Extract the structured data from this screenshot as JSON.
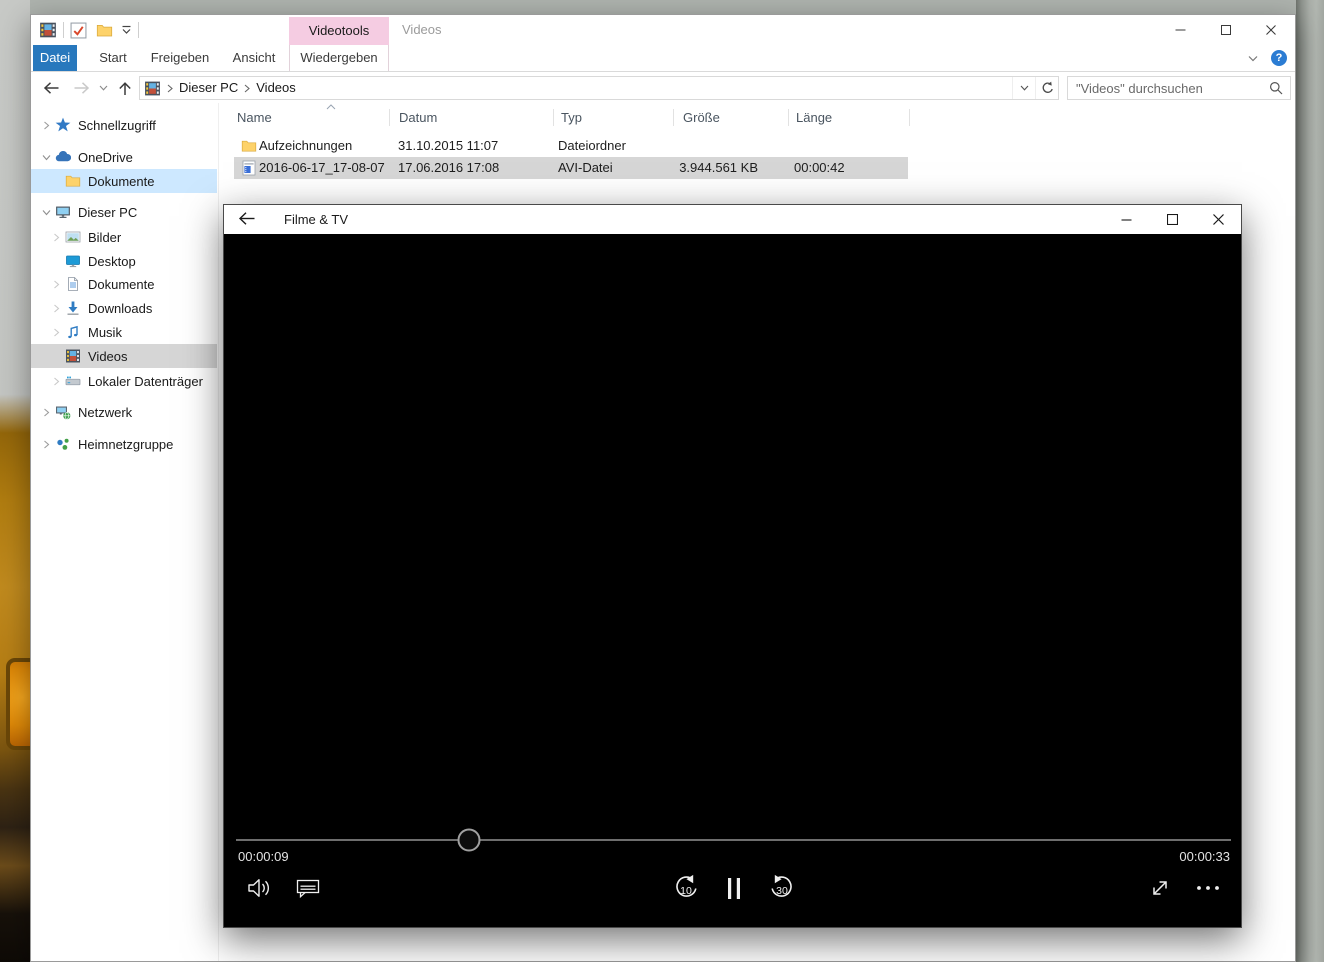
{
  "titlebar": {
    "contextual_group": "Videotools",
    "window_title": "Videos"
  },
  "tabs": {
    "file": "Datei",
    "start": "Start",
    "share": "Freigeben",
    "view": "Ansicht",
    "play": "Wiedergeben"
  },
  "address": {
    "root": "Dieser PC",
    "current": "Videos"
  },
  "search": {
    "placeholder": "\"Videos\" durchsuchen"
  },
  "sidebar": {
    "items": [
      {
        "label": "Schnellzugriff",
        "icon": "quick-access-star",
        "chevron": "right",
        "indent": 0
      },
      {
        "label": "OneDrive",
        "icon": "onedrive-cloud",
        "chevron": "down",
        "indent": 0
      },
      {
        "label": "Dokumente",
        "icon": "folder",
        "chevron": "none",
        "indent": 1,
        "state": "highlighted"
      },
      {
        "label": "Dieser PC",
        "icon": "computer",
        "chevron": "down",
        "indent": 0
      },
      {
        "label": "Bilder",
        "icon": "pictures",
        "chevron": "right",
        "indent": 1
      },
      {
        "label": "Desktop",
        "icon": "desktop",
        "chevron": "none",
        "indent": 1
      },
      {
        "label": "Dokumente",
        "icon": "document",
        "chevron": "right",
        "indent": 1
      },
      {
        "label": "Downloads",
        "icon": "download",
        "chevron": "right",
        "indent": 1
      },
      {
        "label": "Musik",
        "icon": "music-note",
        "chevron": "right",
        "indent": 1
      },
      {
        "label": "Videos",
        "icon": "film-strip",
        "chevron": "none",
        "indent": 1,
        "state": "selected"
      },
      {
        "label": "Lokaler Datenträger",
        "icon": "hard-disk",
        "chevron": "right",
        "indent": 1
      },
      {
        "label": "Netzwerk",
        "icon": "network",
        "chevron": "right",
        "indent": 0
      },
      {
        "label": "Heimnetzgruppe",
        "icon": "homegroup",
        "chevron": "right",
        "indent": 0
      }
    ]
  },
  "files": {
    "columns": [
      "Name",
      "Datum",
      "Typ",
      "Größe",
      "Länge"
    ],
    "sort_column": "Name",
    "sort_direction": "ascending",
    "rows": [
      {
        "name": "Aufzeichnungen",
        "icon": "folder-icon",
        "date": "31.10.2015 11:07",
        "type": "Dateiordner",
        "size": "",
        "length": "",
        "selected": false
      },
      {
        "name": "2016-06-17_17-08-07",
        "icon": "avi-file-icon",
        "date": "17.06.2016 17:08",
        "type": "AVI-Datei",
        "size": "3.944.561 KB",
        "length": "00:00:42",
        "selected": true
      }
    ]
  },
  "player": {
    "title": "Filme & TV",
    "elapsed": "00:00:09",
    "remaining": "00:00:33",
    "progress_pct": 23.4,
    "skip_back_label": "10",
    "skip_forward_label": "30"
  },
  "colors": {
    "accent_blue": "#2878bd",
    "contextual_pink": "#f5cce2",
    "selection_grey": "#d6d6d6",
    "sidebar_highlight": "#cde8ff",
    "player_icon": "#efefef"
  }
}
